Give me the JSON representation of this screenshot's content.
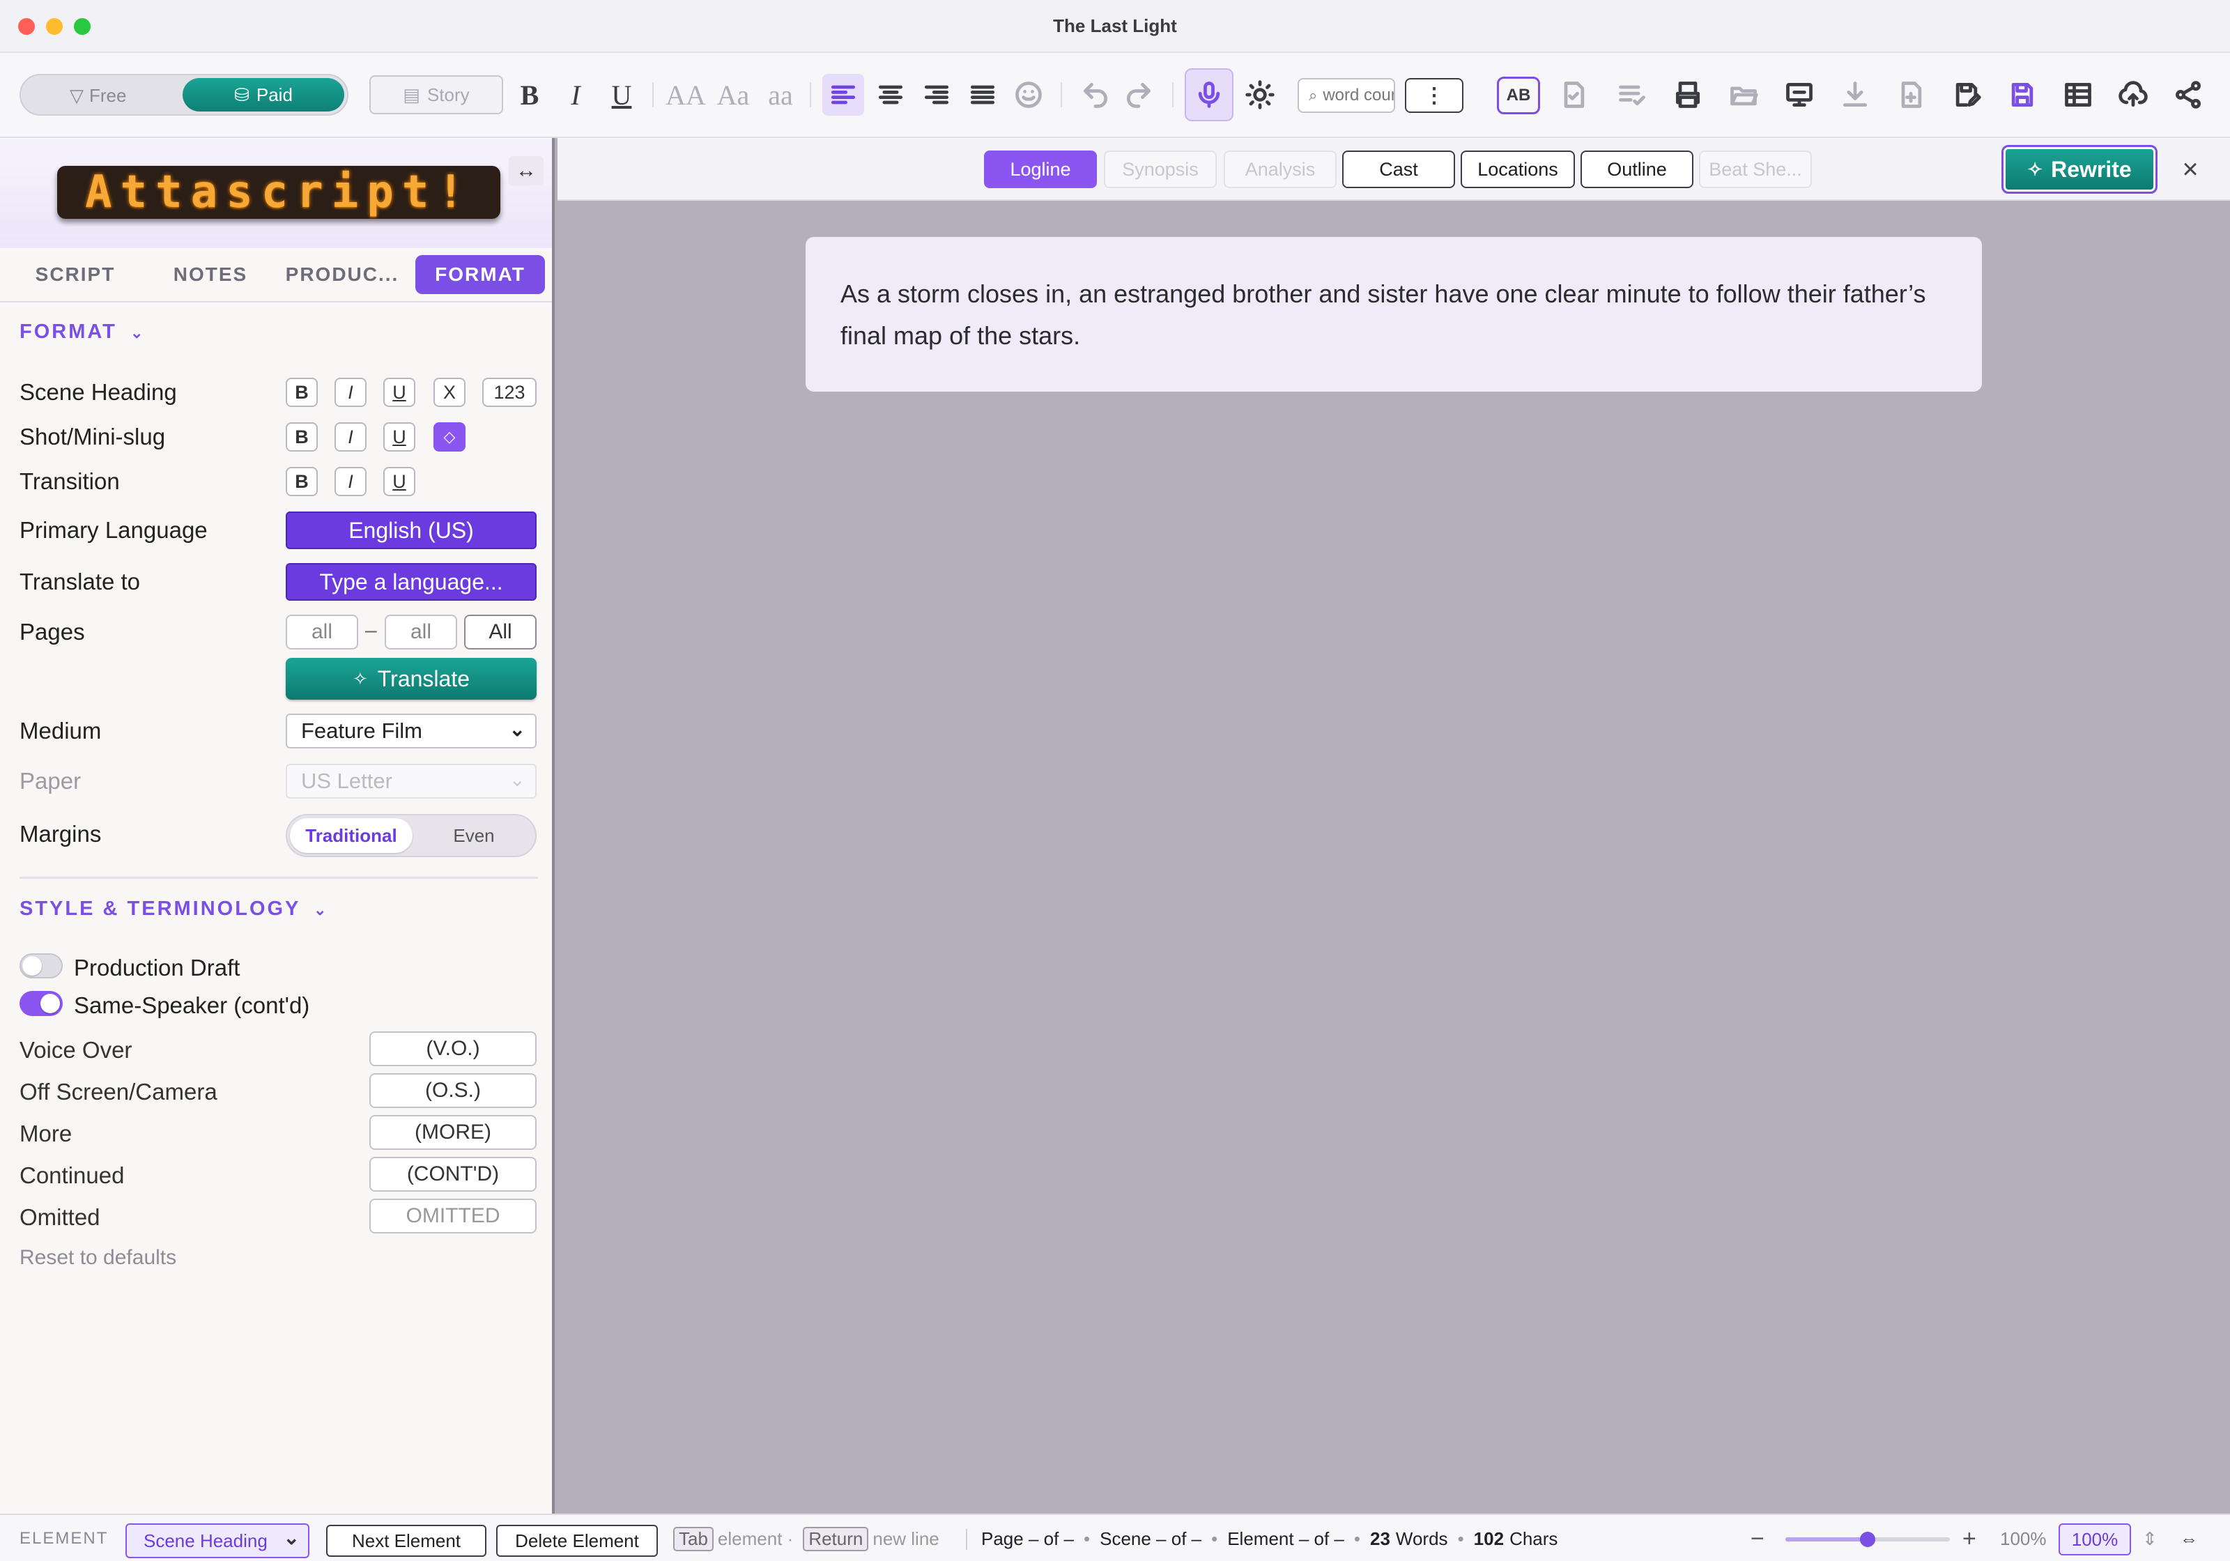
{
  "window": {
    "title": "The Last Light"
  },
  "toolbar": {
    "tier": {
      "free": "Free",
      "paid": "Paid"
    },
    "story_label": "Story",
    "bold": "B",
    "italic": "I",
    "underline": "U",
    "case_upper": "AA",
    "case_title": "Aa",
    "case_lower": "aa",
    "search_placeholder": "word count",
    "spell_label": "AB"
  },
  "sidebar": {
    "logo": "Attascript!",
    "tabs": [
      "SCRIPT",
      "NOTES",
      "PRODUC...",
      "FORMAT"
    ],
    "format": {
      "header": "FORMAT",
      "rows": {
        "scene_heading": "Scene Heading",
        "shot": "Shot/Mini-slug",
        "transition": "Transition",
        "primary_language": "Primary Language",
        "translate_to": "Translate to",
        "pages": "Pages",
        "medium": "Medium",
        "paper": "Paper",
        "margins": "Margins"
      },
      "style_buttons": {
        "b": "B",
        "i": "I",
        "u": "U",
        "x": "X",
        "num": "123"
      },
      "primary_language_value": "English (US)",
      "translate_placeholder": "Type a language...",
      "pages_from": "all",
      "pages_to": "all",
      "pages_all": "All",
      "pages_dash": "–",
      "translate_button": "Translate",
      "medium_value": "Feature Film",
      "paper_value": "US Letter",
      "margins_options": [
        "Traditional",
        "Even"
      ],
      "margins_selected": "Traditional"
    },
    "style": {
      "header": "STYLE & TERMINOLOGY",
      "production_draft": {
        "label": "Production Draft",
        "on": false
      },
      "same_speaker": {
        "label": "Same-Speaker (cont'd)",
        "on": true
      },
      "terms": [
        {
          "label": "Voice Over",
          "value": "(V.O.)"
        },
        {
          "label": "Off Screen/Camera",
          "value": "(O.S.)"
        },
        {
          "label": "More",
          "value": "(MORE)"
        },
        {
          "label": "Continued",
          "value": "(CONT'D)"
        },
        {
          "label": "Omitted",
          "value": "OMITTED"
        }
      ],
      "reset": "Reset to defaults"
    }
  },
  "subtabs": {
    "items": [
      {
        "label": "Logline",
        "state": "active"
      },
      {
        "label": "Synopsis",
        "state": "disabled"
      },
      {
        "label": "Analysis",
        "state": "disabled"
      },
      {
        "label": "Cast",
        "state": "normal"
      },
      {
        "label": "Locations",
        "state": "normal"
      },
      {
        "label": "Outline",
        "state": "normal"
      },
      {
        "label": "Beat She...",
        "state": "disabled"
      }
    ],
    "rewrite": "Rewrite",
    "close": "×"
  },
  "logline": {
    "text": "As a storm closes in, an estranged brother and sister have one clear minute to follow their father’s final map of the stars."
  },
  "statusbar": {
    "element_label": "ELEMENT",
    "element_value": "Scene Heading",
    "next": "Next Element",
    "delete": "Delete Element",
    "tab_key": "Tab",
    "tab_hint": "element ·",
    "return_key": "Return",
    "return_hint": "new line",
    "page": "Page – of –",
    "scene": "Scene – of –",
    "element": "Element – of –",
    "words_count": "23",
    "words_label": "Words",
    "chars_count": "102",
    "chars_label": "Chars",
    "zoom_text": "100%",
    "zoom_box": "100%",
    "zoom_level": 0.5
  },
  "colors": {
    "accent": "#7b4fe6",
    "teal": "#149085",
    "canvas": "#b3b0bb"
  }
}
